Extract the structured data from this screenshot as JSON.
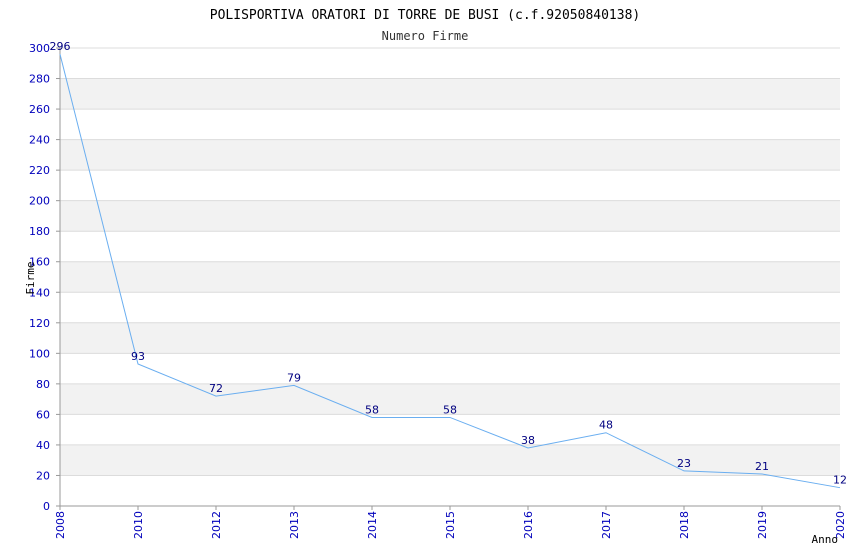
{
  "chart_data": {
    "type": "line",
    "title": "POLISPORTIVA ORATORI DI TORRE DE BUSI (c.f.92050840138)",
    "subtitle": "Numero Firme",
    "xlabel": "Anno",
    "ylabel": "Firme",
    "ylim": [
      0,
      300
    ],
    "y_ticks": [
      0,
      20,
      40,
      60,
      80,
      100,
      120,
      140,
      160,
      180,
      200,
      220,
      240,
      260,
      280,
      300
    ],
    "categories": [
      "2008",
      "2010",
      "2012",
      "2013",
      "2014",
      "2015",
      "2016",
      "2017",
      "2018",
      "2019",
      "2020"
    ],
    "values": [
      296,
      93,
      72,
      79,
      58,
      58,
      38,
      48,
      23,
      21,
      12
    ],
    "grid": "horizontal alternating bands",
    "colors": {
      "line": "#6aaef0",
      "band": "#f2f2f2",
      "grid": "#dcdcdc",
      "tick_text": "#0000bb",
      "data_label": "#000080"
    }
  }
}
